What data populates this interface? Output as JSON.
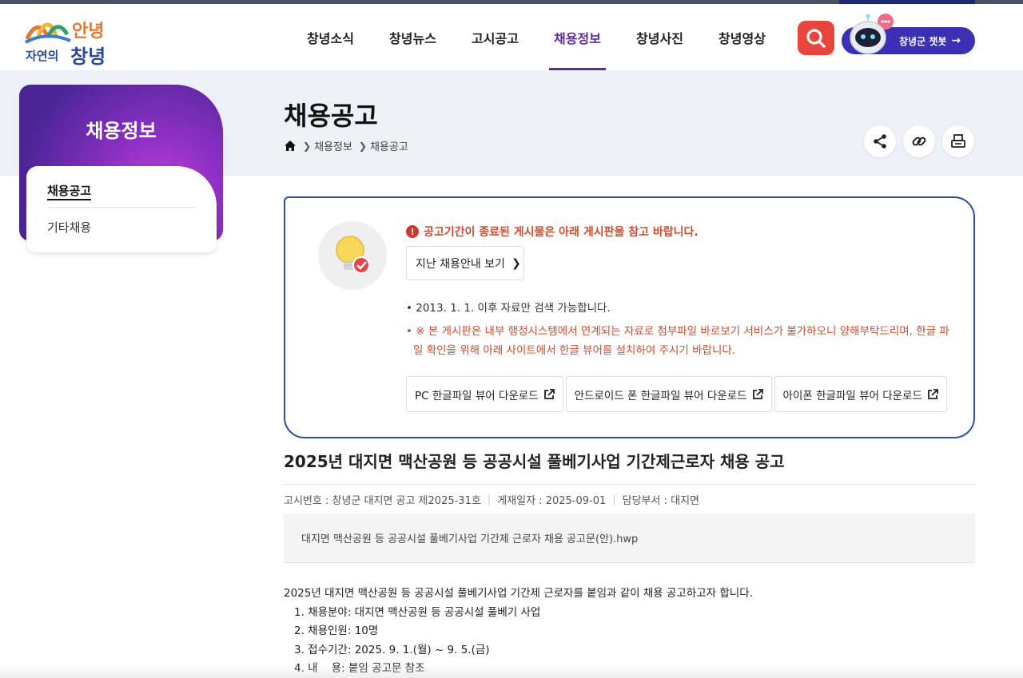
{
  "logo": {
    "line1": "안녕",
    "line2a": "자연의",
    "line2b": "창녕"
  },
  "nav": [
    "창녕소식",
    "창녕뉴스",
    "고시공고",
    "채용정보",
    "창녕사진",
    "창녕영상"
  ],
  "nav_active": "채용정보",
  "chatbot": {
    "label": "창녕군 챗봇",
    "arrow": "→"
  },
  "sidebar": {
    "title": "채용정보",
    "items": [
      "채용공고",
      "기타채용"
    ]
  },
  "page": {
    "title": "채용공고",
    "breadcrumb": [
      "채용정보",
      "채용공고"
    ]
  },
  "notice": {
    "warning": "공고기간이 종료된 게시물은 아래 게시판을 참고 바랍니다.",
    "past_button": "지난 채용안내 보기",
    "bullet1": "• 2013. 1. 1. 이후 자료만 검색 가능합니다.",
    "bullet2": "• ※ 본 게시판은 내부 행정시스템에서 연계되는 자료로 첨부파일 바로보기 서비스가 불가하오니 양해부탁드리며, 한글 파일 확인을 위해 아래 사이트에서 한글 뷰어를 설치하여 주시기 바랍니다.",
    "downloads": [
      "PC 한글파일 뷰어 다운로드",
      "안드로이드 폰 한글파일 뷰어 다운로드",
      "아이폰 한글파일 뷰어 다운로드"
    ]
  },
  "post": {
    "title": "2025년 대지면 맥산공원 등 공공시설 풀베기사업 기간제근로자 채용 공고",
    "meta": [
      "고시번호 : 창녕군 대지면 공고 제2025-31호",
      "게재일자 : 2025-09-01",
      "담당부서 : 대지면"
    ],
    "attachment": "대지면 맥산공원 등 공공시설 풀베기사업 기간제 근로자 채용 공고문(안).hwp",
    "intro": "2025년 대지면 맥산공원 등 공공시설 풀베기사업 기간제 근로자를 붙임과 같이 채용 공고하고자 합니다.",
    "items": [
      "1. 채용분야: 대지면 맥산공원 등 공공시설 풀베기 사업",
      "2. 채용인원: 10명",
      "3. 접수기간: 2025. 9. 1.(월) ~ 9. 5.(금)",
      "4. 내    용: 붙임 공고문 참조"
    ]
  },
  "colors": {
    "accent": "#5a2ca0",
    "search": "#e8453c",
    "chatbot": "#3b2fb5",
    "warning": "#d24b2e",
    "border": "#2c4f9a"
  },
  "icons": {
    "search": "search-icon",
    "share": "share-icon",
    "link": "link-icon",
    "print": "print-icon",
    "home": "home-icon"
  }
}
